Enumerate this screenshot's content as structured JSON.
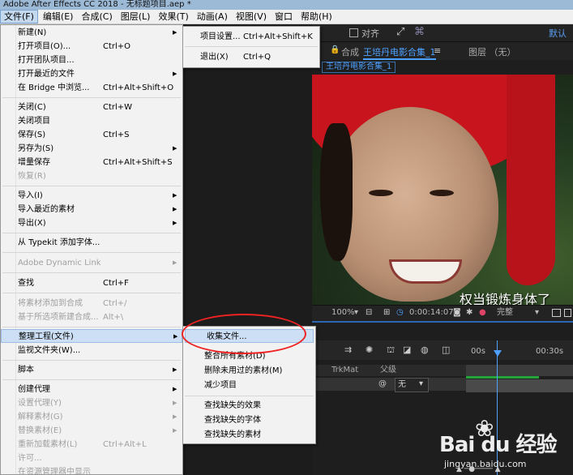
{
  "window": {
    "title": "Adobe After Effects CC 2018 - 无标题项目.aep *"
  },
  "menubar": {
    "items": [
      "文件(F)",
      "编辑(E)",
      "合成(C)",
      "图层(L)",
      "效果(T)",
      "动画(A)",
      "视图(V)",
      "窗口",
      "帮助(H)"
    ],
    "active_index": 0
  },
  "toolbar": {
    "align_label": "对齐",
    "workspace_label": "默认"
  },
  "comp_panel": {
    "lock_icon": "lock-icon",
    "comp_label": "合成",
    "comp_name": "王培丹电影合集_1",
    "layer_label": "图层 （无）",
    "tab_chip": "王培丹电影合集_1"
  },
  "viewer": {
    "subtitle": "权当锻炼身体了"
  },
  "viewer_controls": {
    "zoom": "100%",
    "timecode": "0:00:14:07",
    "resolution": "完整"
  },
  "timeline": {
    "ruler_labels": [
      "00s",
      "00:30s"
    ],
    "columns": {
      "trkmat": "TrkMat",
      "parent": "父级"
    },
    "row": {
      "parent_value": "无"
    }
  },
  "file_menu": {
    "items": [
      {
        "label": "新建(N)",
        "shortcut": "",
        "submenu": true,
        "disabled": false
      },
      {
        "label": "打开项目(O)...",
        "shortcut": "Ctrl+O",
        "submenu": false,
        "disabled": false
      },
      {
        "label": "打开团队项目...",
        "shortcut": "",
        "submenu": false,
        "disabled": false
      },
      {
        "label": "打开最近的文件",
        "shortcut": "",
        "submenu": true,
        "disabled": false
      },
      {
        "label": "在 Bridge 中浏览...",
        "shortcut": "Ctrl+Alt+Shift+O",
        "submenu": false,
        "disabled": false
      },
      {
        "label": "关闭(C)",
        "shortcut": "Ctrl+W",
        "submenu": false,
        "disabled": false
      },
      {
        "label": "关闭项目",
        "shortcut": "",
        "submenu": false,
        "disabled": false
      },
      {
        "label": "保存(S)",
        "shortcut": "Ctrl+S",
        "submenu": false,
        "disabled": false
      },
      {
        "label": "另存为(S)",
        "shortcut": "",
        "submenu": true,
        "disabled": false
      },
      {
        "label": "增量保存",
        "shortcut": "Ctrl+Alt+Shift+S",
        "submenu": false,
        "disabled": false
      },
      {
        "label": "恢复(R)",
        "shortcut": "",
        "submenu": false,
        "disabled": true
      },
      {
        "label": "导入(I)",
        "shortcut": "",
        "submenu": true,
        "disabled": false
      },
      {
        "label": "导入最近的素材",
        "shortcut": "",
        "submenu": true,
        "disabled": false
      },
      {
        "label": "导出(X)",
        "shortcut": "",
        "submenu": true,
        "disabled": false
      },
      {
        "label": "从 Typekit 添加字体...",
        "shortcut": "",
        "submenu": false,
        "disabled": false
      },
      {
        "label": "Adobe Dynamic Link",
        "shortcut": "",
        "submenu": true,
        "disabled": true
      },
      {
        "label": "查找",
        "shortcut": "Ctrl+F",
        "submenu": false,
        "disabled": false
      },
      {
        "label": "将素材添加到合成",
        "shortcut": "Ctrl+/",
        "submenu": false,
        "disabled": true
      },
      {
        "label": "基于所选项新建合成...",
        "shortcut": "Alt+\\",
        "submenu": false,
        "disabled": true
      },
      {
        "label": "整理工程(文件)",
        "shortcut": "",
        "submenu": true,
        "disabled": false
      },
      {
        "label": "监视文件夹(W)...",
        "shortcut": "",
        "submenu": false,
        "disabled": false
      },
      {
        "label": "脚本",
        "shortcut": "",
        "submenu": true,
        "disabled": false
      },
      {
        "label": "创建代理",
        "shortcut": "",
        "submenu": true,
        "disabled": false
      },
      {
        "label": "设置代理(Y)",
        "shortcut": "",
        "submenu": true,
        "disabled": true
      },
      {
        "label": "解释素材(G)",
        "shortcut": "",
        "submenu": true,
        "disabled": true
      },
      {
        "label": "替换素材(E)",
        "shortcut": "",
        "submenu": true,
        "disabled": true
      },
      {
        "label": "重新加载素材(L)",
        "shortcut": "Ctrl+Alt+L",
        "submenu": false,
        "disabled": true
      },
      {
        "label": "许可...",
        "shortcut": "",
        "submenu": false,
        "disabled": true
      },
      {
        "label": "在资源管理器中显示",
        "shortcut": "",
        "submenu": false,
        "disabled": true
      }
    ]
  },
  "project_submenu": {
    "items": [
      {
        "label": "项目设置...",
        "shortcut": "Ctrl+Alt+Shift+K"
      },
      {
        "label": "退出(X)",
        "shortcut": "Ctrl+Q"
      }
    ]
  },
  "dependencies_submenu": {
    "items": [
      "收集文件...",
      "整合所有素材(D)",
      "删除未用过的素材(M)",
      "减少项目",
      "查找缺失的效果",
      "查找缺失的字体",
      "查找缺失的素材"
    ],
    "highlighted_index": 0
  },
  "watermark": {
    "brand": "Bai du 经验",
    "site": "jingyan.baidu.com"
  },
  "colors": {
    "accent": "#4ea1ff",
    "menu_highlight": "#ccdff4",
    "annotation_circle": "#e22222"
  }
}
